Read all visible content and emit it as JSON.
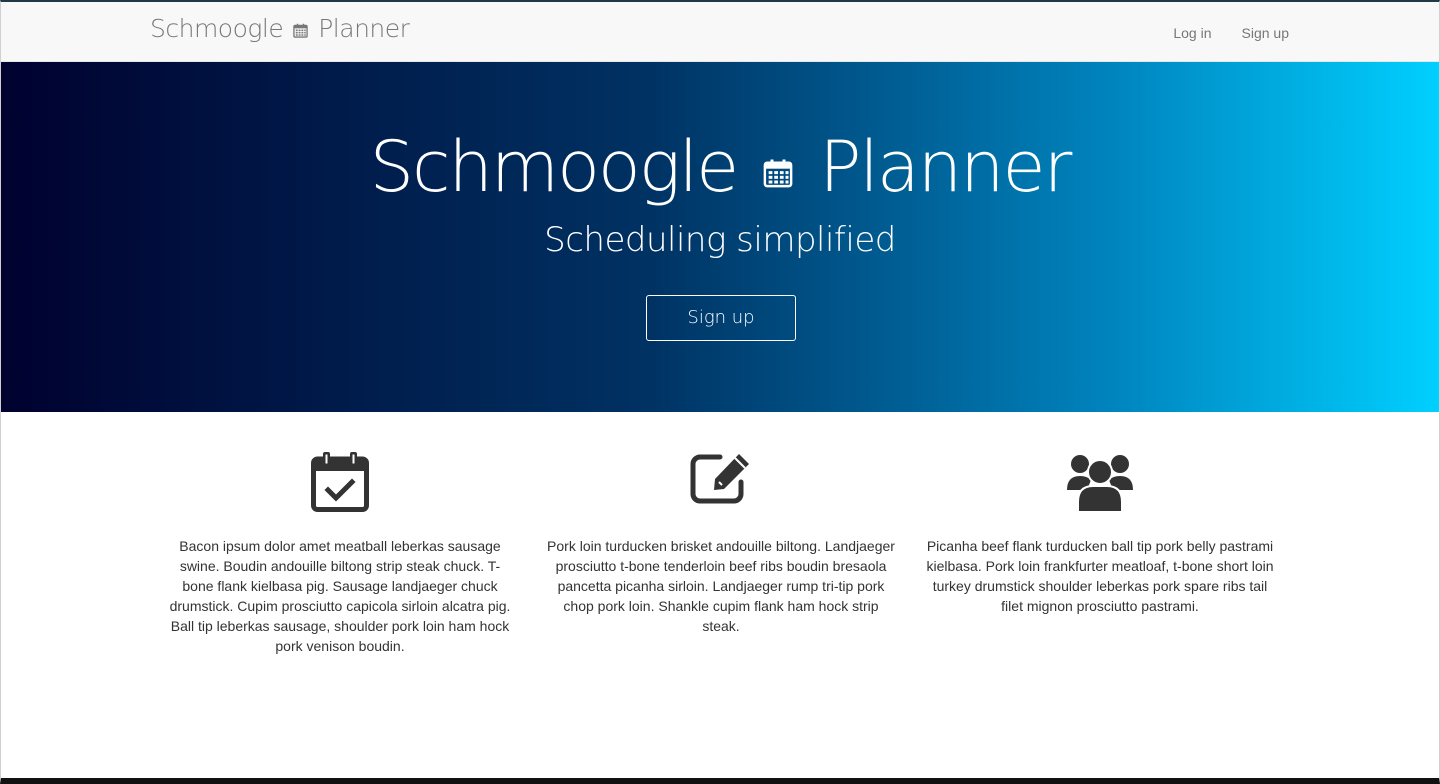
{
  "navbar": {
    "brand_left": "Schmoogle",
    "brand_right": "Planner",
    "links": [
      "Log in",
      "Sign up"
    ]
  },
  "hero": {
    "title_left": "Schmoogle",
    "title_right": "Planner",
    "subtitle": "Scheduling simplified",
    "cta_label": "Sign up",
    "gradient": [
      "#00012f",
      "#003263",
      "#0086c0",
      "#00d0ff"
    ]
  },
  "features": [
    {
      "icon": "calendar-check-icon",
      "text": "Bacon ipsum dolor amet meatball leberkas sausage swine. Boudin andouille biltong strip steak chuck. T-bone flank kielbasa pig. Sausage landjaeger chuck drumstick. Cupim prosciutto capicola sirloin alcatra pig. Ball tip leberkas sausage, shoulder pork loin ham hock pork venison boudin."
    },
    {
      "icon": "edit-icon",
      "text": "Pork loin turducken brisket andouille biltong. Landjaeger prosciutto t-bone tenderloin beef ribs boudin bresaola pancetta picanha sirloin. Landjaeger rump tri-tip pork chop pork loin. Shankle cupim flank ham hock strip steak."
    },
    {
      "icon": "users-icon",
      "text": "Picanha beef flank turducken ball tip pork belly pastrami kielbasa. Pork loin frankfurter meatloaf, t-bone short loin turkey drumstick shoulder leberkas pork spare ribs tail filet mignon prosciutto pastrami."
    }
  ],
  "colors": {
    "navbar_bg": "#f8f8f8",
    "navbar_text": "#777777",
    "body_text": "#333333",
    "icon": "#333333"
  }
}
